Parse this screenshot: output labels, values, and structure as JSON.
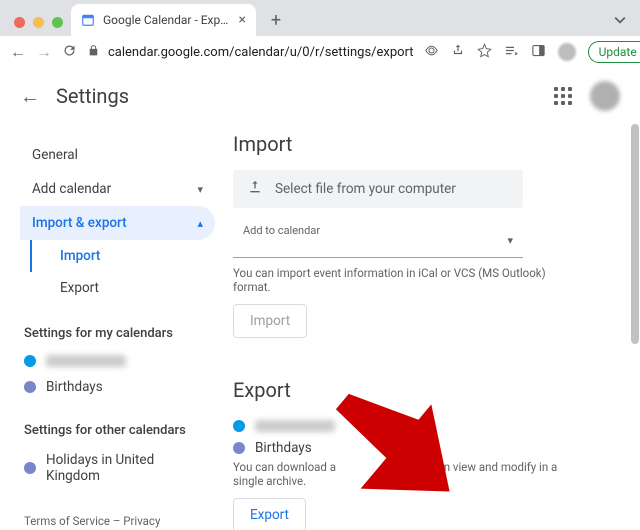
{
  "browser": {
    "tab_title": "Google Calendar - Export/impo",
    "url": "calendar.google.com/calendar/u/0/r/settings/export",
    "update_label": "Update"
  },
  "header": {
    "title": "Settings"
  },
  "sidebar": {
    "items": [
      {
        "label": "General"
      },
      {
        "label": "Add calendar"
      },
      {
        "label": "Import & export"
      }
    ],
    "sub_items": [
      {
        "label": "Import"
      },
      {
        "label": "Export"
      }
    ],
    "my_cal_heading": "Settings for my calendars",
    "my_cals": [
      {
        "label_hidden": true
      },
      {
        "label": "Birthdays"
      }
    ],
    "other_cal_heading": "Settings for other calendars",
    "other_cals": [
      {
        "label": "Holidays in United Kingdom"
      }
    ],
    "footer": "Terms of Service – Privacy"
  },
  "import": {
    "heading": "Import",
    "file_select": "Select file from your computer",
    "add_to_label": "Add to calendar",
    "hint": "You can import event information in iCal or VCS (MS Outlook) format.",
    "button": "Import"
  },
  "export": {
    "heading": "Export",
    "cal1_hidden": true,
    "cal2": "Birthdays",
    "hint_pre": "You can download a",
    "hint_post": "that you can view and modify in a single archive.",
    "button": "Export"
  }
}
